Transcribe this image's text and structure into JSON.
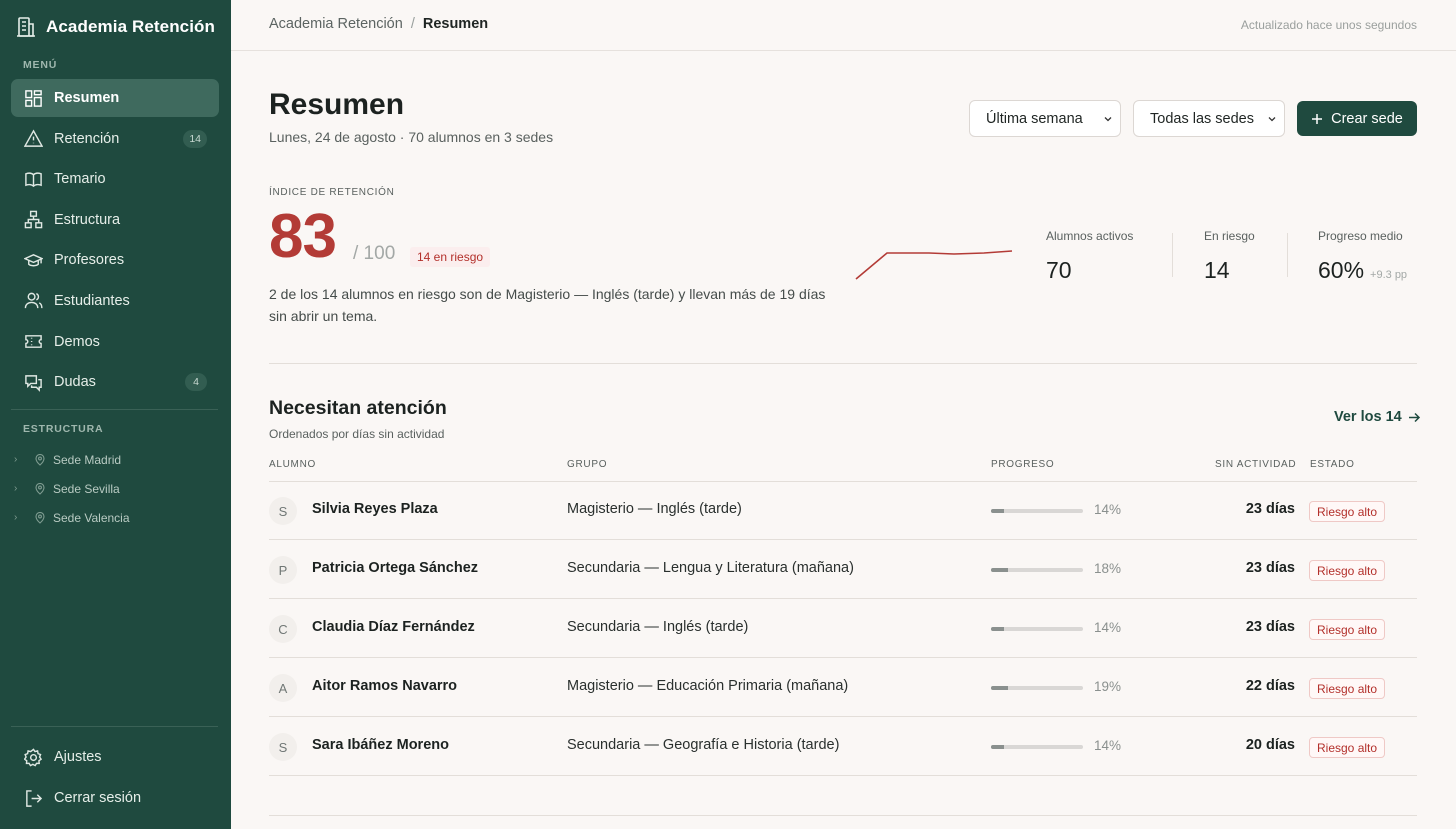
{
  "app": {
    "name": "Academia Retención"
  },
  "sidebar": {
    "menu_label": "MENÚ",
    "items": [
      {
        "label": "Resumen",
        "icon": "dashboard-icon",
        "active": true
      },
      {
        "label": "Retención",
        "icon": "warning-icon",
        "badge": "14"
      },
      {
        "label": "Temario",
        "icon": "book-icon"
      },
      {
        "label": "Estructura",
        "icon": "hierarchy-icon"
      },
      {
        "label": "Profesores",
        "icon": "graduation-cap-icon"
      },
      {
        "label": "Estudiantes",
        "icon": "users-icon"
      },
      {
        "label": "Demos",
        "icon": "ticket-icon"
      },
      {
        "label": "Dudas",
        "icon": "chat-icon",
        "badge": "4"
      }
    ],
    "structure_label": "ESTRUCTURA",
    "sedes": [
      "Sede Madrid",
      "Sede Sevilla",
      "Sede Valencia"
    ],
    "bottom": [
      {
        "label": "Ajustes",
        "icon": "gear-icon"
      },
      {
        "label": "Cerrar sesión",
        "icon": "logout-icon"
      }
    ]
  },
  "topbar": {
    "breadcrumb_parent": "Academia Retención",
    "breadcrumb_sep": "/",
    "breadcrumb_current": "Resumen",
    "updated": "Actualizado hace unos segundos"
  },
  "header": {
    "title": "Resumen",
    "subtitle": "Lunes, 24 de agosto · 70 alumnos en 3 sedes",
    "period_select": "Última semana",
    "sede_select": "Todas las sedes",
    "create_button": "Crear sede"
  },
  "retention": {
    "label": "ÍNDICE DE RETENCIÓN",
    "score": "83",
    "max": "/ 100",
    "risk_pill": "14 en riesgo",
    "text": "2 de los 14 alumnos en riesgo son de Magisterio — Inglés (tarde) y llevan más de 19 días sin abrir un tema.",
    "sparkline_color": "#b33b36",
    "stats": [
      {
        "label": "Alumnos activos",
        "value": "70"
      },
      {
        "label": "En riesgo",
        "value": "14"
      },
      {
        "label": "Progreso medio",
        "value": "60%",
        "delta": "+9.3 pp"
      }
    ]
  },
  "attention": {
    "title": "Necesitan atención",
    "subtitle": "Ordenados por días sin actividad",
    "see_all": "Ver los 14",
    "columns": {
      "student": "ALUMNO",
      "group": "GRUPO",
      "progress": "PROGRESO",
      "inactive": "SIN ACTIVIDAD",
      "status": "ESTADO"
    },
    "rows": [
      {
        "initial": "S",
        "name": "Silvia Reyes Plaza",
        "group": "Magisterio — Inglés (tarde)",
        "progress": 14,
        "progress_label": "14%",
        "inactive": "23 días",
        "status": "Riesgo alto"
      },
      {
        "initial": "P",
        "name": "Patricia Ortega Sánchez",
        "group": "Secundaria — Lengua y Literatura (mañana)",
        "progress": 18,
        "progress_label": "18%",
        "inactive": "23 días",
        "status": "Riesgo alto"
      },
      {
        "initial": "C",
        "name": "Claudia Díaz Fernández",
        "group": "Secundaria — Inglés (tarde)",
        "progress": 14,
        "progress_label": "14%",
        "inactive": "23 días",
        "status": "Riesgo alto"
      },
      {
        "initial": "A",
        "name": "Aitor Ramos Navarro",
        "group": "Magisterio — Educación Primaria (mañana)",
        "progress": 19,
        "progress_label": "19%",
        "inactive": "22 días",
        "status": "Riesgo alto"
      },
      {
        "initial": "S",
        "name": "Sara Ibáñez Moreno",
        "group": "Secundaria — Geografía e Historia (tarde)",
        "progress": 14,
        "progress_label": "14%",
        "inactive": "20 días",
        "status": "Riesgo alto"
      }
    ]
  },
  "colors": {
    "sidebar": "#1f4a3f",
    "accent": "#1f4a3f",
    "danger": "#b33b36"
  }
}
